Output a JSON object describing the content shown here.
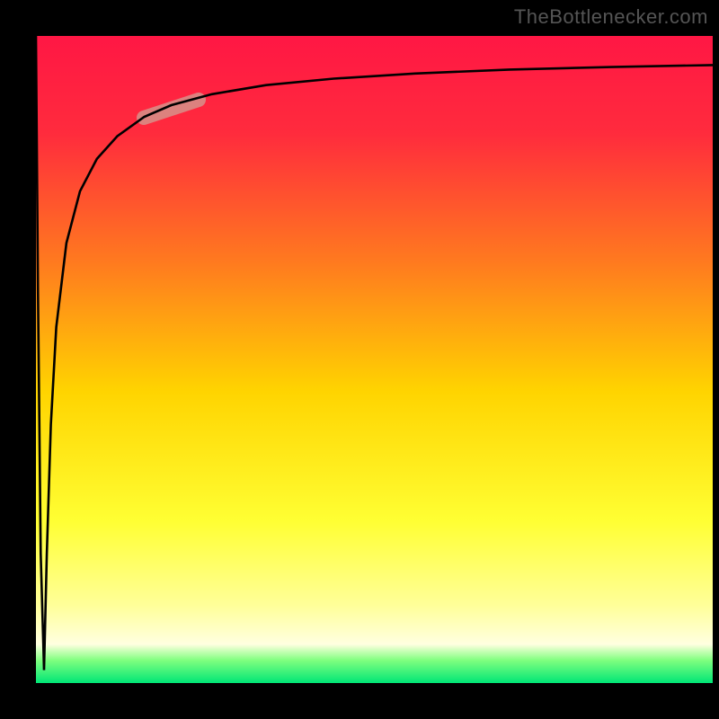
{
  "watermark": "TheBottlenecker.com",
  "chart_data": {
    "type": "line",
    "title": "",
    "xlabel": "",
    "ylabel": "",
    "xlim": [
      0,
      100
    ],
    "ylim": [
      0,
      100
    ],
    "background_gradient": {
      "stops": [
        {
          "pos": 0.0,
          "color": "#ff1744"
        },
        {
          "pos": 0.15,
          "color": "#ff2b3d"
        },
        {
          "pos": 0.35,
          "color": "#ff7a1f"
        },
        {
          "pos": 0.55,
          "color": "#ffd400"
        },
        {
          "pos": 0.75,
          "color": "#ffff33"
        },
        {
          "pos": 0.88,
          "color": "#ffff99"
        },
        {
          "pos": 0.94,
          "color": "#ffffe0"
        },
        {
          "pos": 0.965,
          "color": "#7fff7f"
        },
        {
          "pos": 1.0,
          "color": "#00e676"
        }
      ]
    },
    "series": [
      {
        "name": "bottleneck-curve",
        "stroke": "#000000",
        "points": [
          {
            "x": 0.0,
            "y": 100.0
          },
          {
            "x": 0.3,
            "y": 60.0
          },
          {
            "x": 0.7,
            "y": 20.0
          },
          {
            "x": 1.2,
            "y": 2.0
          },
          {
            "x": 1.6,
            "y": 20.0
          },
          {
            "x": 2.2,
            "y": 40.0
          },
          {
            "x": 3.0,
            "y": 55.0
          },
          {
            "x": 4.5,
            "y": 68.0
          },
          {
            "x": 6.5,
            "y": 76.0
          },
          {
            "x": 9.0,
            "y": 81.0
          },
          {
            "x": 12.0,
            "y": 84.5
          },
          {
            "x": 16.0,
            "y": 87.5
          },
          {
            "x": 20.0,
            "y": 89.3
          },
          {
            "x": 26.0,
            "y": 91.0
          },
          {
            "x": 34.0,
            "y": 92.4
          },
          {
            "x": 44.0,
            "y": 93.4
          },
          {
            "x": 56.0,
            "y": 94.2
          },
          {
            "x": 70.0,
            "y": 94.8
          },
          {
            "x": 85.0,
            "y": 95.2
          },
          {
            "x": 100.0,
            "y": 95.5
          }
        ]
      }
    ],
    "highlight": {
      "name": "highlight-segment",
      "color": "#d98c86",
      "x_range": [
        16,
        24
      ],
      "y_range": [
        87,
        90
      ]
    }
  }
}
